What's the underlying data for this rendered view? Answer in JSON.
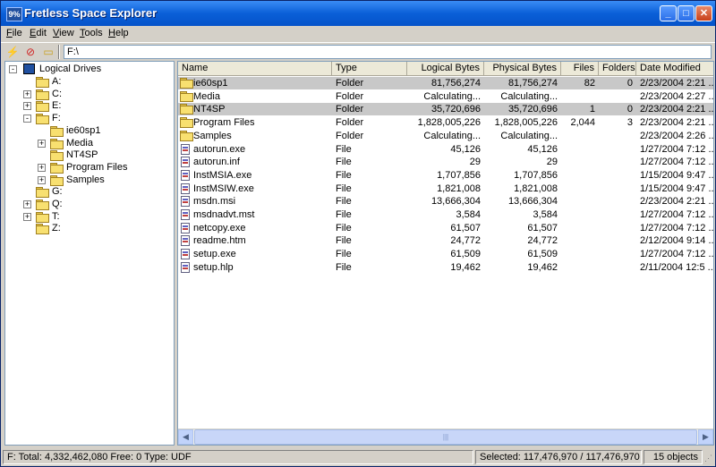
{
  "window": {
    "title": "Fretless Space Explorer",
    "icon_text": "9%"
  },
  "menu": [
    {
      "label": "File",
      "key": "F",
      "rest": "ile"
    },
    {
      "label": "Edit",
      "key": "E",
      "rest": "dit"
    },
    {
      "label": "View",
      "key": "V",
      "rest": "iew"
    },
    {
      "label": "Tools",
      "key": "T",
      "rest": "ools"
    },
    {
      "label": "Help",
      "key": "H",
      "rest": "elp"
    }
  ],
  "toolbar": {
    "address": "F:\\"
  },
  "tree": {
    "root": "Logical Drives",
    "nodes": [
      {
        "label": "A:",
        "level": 1,
        "expander": ""
      },
      {
        "label": "C:",
        "level": 1,
        "expander": "+"
      },
      {
        "label": "E:",
        "level": 1,
        "expander": "+"
      },
      {
        "label": "F:",
        "level": 1,
        "expander": "-"
      },
      {
        "label": "ie60sp1",
        "level": 2,
        "expander": ""
      },
      {
        "label": "Media",
        "level": 2,
        "expander": "+"
      },
      {
        "label": "NT4SP",
        "level": 2,
        "expander": ""
      },
      {
        "label": "Program Files",
        "level": 2,
        "expander": "+"
      },
      {
        "label": "Samples",
        "level": 2,
        "expander": "+"
      },
      {
        "label": "G:",
        "level": 1,
        "expander": ""
      },
      {
        "label": "Q:",
        "level": 1,
        "expander": "+"
      },
      {
        "label": "T:",
        "level": 1,
        "expander": "+"
      },
      {
        "label": "Z:",
        "level": 1,
        "expander": ""
      }
    ]
  },
  "columns": {
    "name": "Name",
    "type": "Type",
    "logical": "Logical Bytes",
    "physical": "Physical Bytes",
    "files": "Files",
    "folders": "Folders",
    "date": "Date Modified"
  },
  "rows": [
    {
      "name": "ie60sp1",
      "type": "Folder",
      "logical": "81,756,274",
      "physical": "81,756,274",
      "files": "82",
      "folders": "0",
      "date": "2/23/2004 2:21 ...",
      "icon": "folder",
      "selected": true
    },
    {
      "name": "Media",
      "type": "Folder",
      "logical": "Calculating...",
      "physical": "Calculating...",
      "files": "",
      "folders": "",
      "date": "2/23/2004 2:27 ...",
      "icon": "folder",
      "selected": false
    },
    {
      "name": "NT4SP",
      "type": "Folder",
      "logical": "35,720,696",
      "physical": "35,720,696",
      "files": "1",
      "folders": "0",
      "date": "2/23/2004 2:21 ...",
      "icon": "folder",
      "selected": true
    },
    {
      "name": "Program Files",
      "type": "Folder",
      "logical": "1,828,005,226",
      "physical": "1,828,005,226",
      "files": "2,044",
      "folders": "3",
      "date": "2/23/2004 2:21 ...",
      "icon": "folder",
      "selected": false
    },
    {
      "name": "Samples",
      "type": "Folder",
      "logical": "Calculating...",
      "physical": "Calculating...",
      "files": "",
      "folders": "",
      "date": "2/23/2004 2:26 ...",
      "icon": "folder",
      "selected": false
    },
    {
      "name": "autorun.exe",
      "type": "File",
      "logical": "45,126",
      "physical": "45,126",
      "files": "",
      "folders": "",
      "date": "1/27/2004 7:12 ...",
      "icon": "file",
      "selected": false
    },
    {
      "name": "autorun.inf",
      "type": "File",
      "logical": "29",
      "physical": "29",
      "files": "",
      "folders": "",
      "date": "1/27/2004 7:12 ...",
      "icon": "file",
      "selected": false
    },
    {
      "name": "InstMSIA.exe",
      "type": "File",
      "logical": "1,707,856",
      "physical": "1,707,856",
      "files": "",
      "folders": "",
      "date": "1/15/2004 9:47 ...",
      "icon": "file",
      "selected": false
    },
    {
      "name": "InstMSIW.exe",
      "type": "File",
      "logical": "1,821,008",
      "physical": "1,821,008",
      "files": "",
      "folders": "",
      "date": "1/15/2004 9:47 ...",
      "icon": "file",
      "selected": false
    },
    {
      "name": "msdn.msi",
      "type": "File",
      "logical": "13,666,304",
      "physical": "13,666,304",
      "files": "",
      "folders": "",
      "date": "2/23/2004 2:21 ...",
      "icon": "file",
      "selected": false
    },
    {
      "name": "msdnadvt.mst",
      "type": "File",
      "logical": "3,584",
      "physical": "3,584",
      "files": "",
      "folders": "",
      "date": "1/27/2004 7:12 ...",
      "icon": "file",
      "selected": false
    },
    {
      "name": "netcopy.exe",
      "type": "File",
      "logical": "61,507",
      "physical": "61,507",
      "files": "",
      "folders": "",
      "date": "1/27/2004 7:12 ...",
      "icon": "file",
      "selected": false
    },
    {
      "name": "readme.htm",
      "type": "File",
      "logical": "24,772",
      "physical": "24,772",
      "files": "",
      "folders": "",
      "date": "2/12/2004 9:14 ...",
      "icon": "file",
      "selected": false
    },
    {
      "name": "setup.exe",
      "type": "File",
      "logical": "61,509",
      "physical": "61,509",
      "files": "",
      "folders": "",
      "date": "1/27/2004 7:12 ...",
      "icon": "file",
      "selected": false
    },
    {
      "name": "setup.hlp",
      "type": "File",
      "logical": "19,462",
      "physical": "19,462",
      "files": "",
      "folders": "",
      "date": "2/11/2004 12:5 ...",
      "icon": "file",
      "selected": false
    }
  ],
  "status": {
    "drive_info": "F:   Total: 4,332,462,080   Free: 0   Type: UDF",
    "selected": "Selected: 117,476,970 / 117,476,970 bytes",
    "count": "15 objects"
  },
  "colors": {
    "selection": "#c8c8c8",
    "titlebar": "#0a5fd8"
  }
}
